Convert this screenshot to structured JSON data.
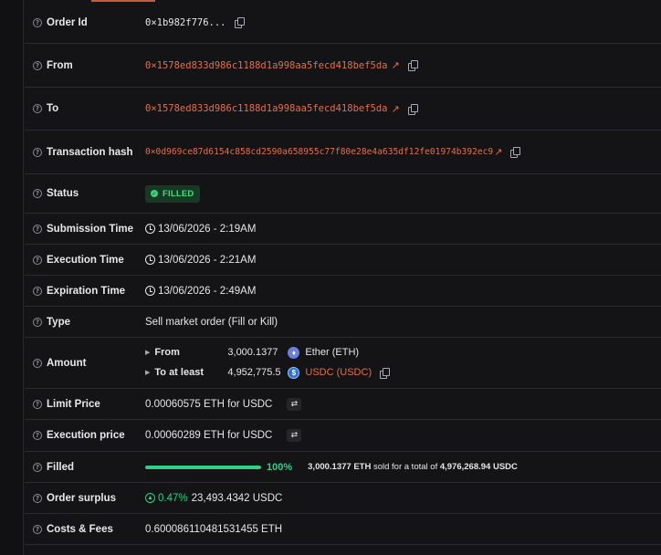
{
  "colors": {
    "accent": "#e0704f",
    "success": "#2fcf8a",
    "background": "#141416"
  },
  "rows": {
    "order_id": {
      "label": "Order Id",
      "value": "0×1b982f776..."
    },
    "from": {
      "label": "From",
      "value": "0×1578ed833d986c1188d1a998aa5fecd418bef5da"
    },
    "to": {
      "label": "To",
      "value": "0×1578ed833d986c1188d1a998aa5fecd418bef5da"
    },
    "tx_hash": {
      "label": "Transaction hash",
      "value": "0×0d969ce87d6154c858cd2590a658955c77f80e28e4a635df12fe01974b392ec9"
    },
    "status": {
      "label": "Status",
      "value": "FILLED"
    },
    "submission_time": {
      "label": "Submission Time",
      "value": "13/06/2026 - 2:19AM"
    },
    "execution_time": {
      "label": "Execution Time",
      "value": "13/06/2026 - 2:21AM"
    },
    "expiration_time": {
      "label": "Expiration Time",
      "value": "13/06/2026 - 2:49AM"
    },
    "type": {
      "label": "Type",
      "value": "Sell market order (Fill or Kill)"
    },
    "amount": {
      "label": "Amount",
      "from_label": "From",
      "from_value": "3,000.1377",
      "from_token": "Ether (ETH)",
      "to_label": "To at least",
      "to_value": "4,952,775.5",
      "to_token": "USDC (USDC)"
    },
    "limit_price": {
      "label": "Limit Price",
      "value": "0.00060575 ETH for USDC"
    },
    "execution_price": {
      "label": "Execution price",
      "value": "0.00060289 ETH for USDC"
    },
    "filled": {
      "label": "Filled",
      "percent_text": "100%",
      "progress": 1.0,
      "amount": "3,000.1377 ETH",
      "middle": "sold for a total of",
      "total": "4,976,268.94 USDC"
    },
    "order_surplus": {
      "label": "Order surplus",
      "percent": "0.47%",
      "value": "23,493.4342 USDC"
    },
    "costs_fees": {
      "label": "Costs & Fees",
      "value": "0.600086110481531455 ETH"
    }
  },
  "icons": {
    "help": "question-circle-icon",
    "copy": "copy-icon",
    "external": "external-link-icon",
    "clock": "clock-icon",
    "swap": "swap-icon",
    "check": "check-circle-icon"
  }
}
